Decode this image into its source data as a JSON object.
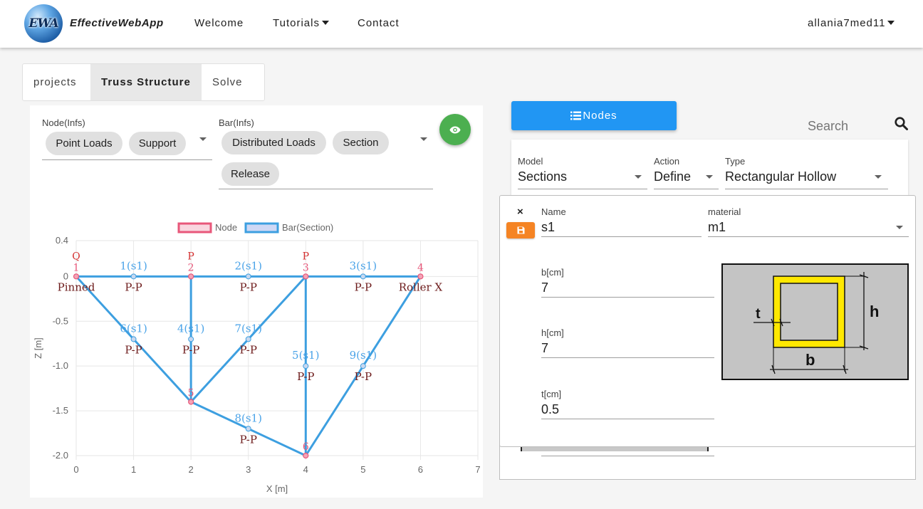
{
  "navbar": {
    "logo_text": "EWA",
    "brand": "EffectiveWebApp",
    "links": [
      {
        "label": "Welcome"
      },
      {
        "label": "Tutorials"
      },
      {
        "label": "Contact"
      }
    ],
    "user": "allania7med11"
  },
  "tabs": [
    {
      "label": "projects"
    },
    {
      "label": "Truss Structure"
    },
    {
      "label": "Solve"
    }
  ],
  "left_panel": {
    "node_infos": {
      "label": "Node(Infs)",
      "chips": [
        "Point Loads",
        "Support"
      ]
    },
    "bar_infos": {
      "label": "Bar(Infs)",
      "chips": [
        "Distributed Loads",
        "Section",
        "Release"
      ]
    },
    "eye_icon": "eye-icon"
  },
  "chart_data": {
    "type": "scatter",
    "title": "",
    "xlabel": "X [m]",
    "ylabel": "Z [m]",
    "xlim": [
      0,
      7
    ],
    "ylim": [
      -2.0,
      0.4
    ],
    "x_ticks": [
      "0",
      "1",
      "2",
      "3",
      "4",
      "5",
      "6",
      "7"
    ],
    "y_ticks": [
      "0.4",
      "0",
      "-0.5",
      "-1.0",
      "-1.5",
      "-2.0"
    ],
    "legend": [
      {
        "name": "Node",
        "color": "#e8577a"
      },
      {
        "name": "Bar(Section)",
        "color": "#3d9fe0"
      }
    ],
    "grid": true,
    "nodes": [
      {
        "id": "1",
        "x": 0,
        "y": 0,
        "support": "Pinned",
        "load": "Q"
      },
      {
        "id": "2",
        "x": 2,
        "y": 0,
        "support": "",
        "load": "P"
      },
      {
        "id": "3",
        "x": 4,
        "y": 0,
        "support": "",
        "load": "P"
      },
      {
        "id": "4",
        "x": 6,
        "y": 0,
        "support": "Roller X",
        "load": ""
      },
      {
        "id": "5",
        "x": 2,
        "y": -1.4,
        "support": "",
        "load": ""
      },
      {
        "id": "6",
        "x": 4,
        "y": -2.0,
        "support": "",
        "load": ""
      }
    ],
    "bars": [
      {
        "label": "1(s1)",
        "release": "P-P",
        "x1": 0,
        "y1": 0,
        "x2": 2,
        "y2": 0
      },
      {
        "label": "2(s1)",
        "release": "P-P",
        "x1": 2,
        "y1": 0,
        "x2": 4,
        "y2": 0
      },
      {
        "label": "3(s1)",
        "release": "P-P",
        "x1": 4,
        "y1": 0,
        "x2": 6,
        "y2": 0
      },
      {
        "label": "4(s1)",
        "release": "P-P",
        "x1": 2,
        "y1": 0,
        "x2": 2,
        "y2": -1.4
      },
      {
        "label": "5(s1)",
        "release": "P-P",
        "x1": 4,
        "y1": 0,
        "x2": 4,
        "y2": -2.0
      },
      {
        "label": "6(s1)",
        "release": "P-P",
        "x1": 0,
        "y1": 0,
        "x2": 2,
        "y2": -1.4
      },
      {
        "label": "7(s1)",
        "release": "P-P",
        "x1": 4,
        "y1": 0,
        "x2": 2,
        "y2": -1.4
      },
      {
        "label": "8(s1)",
        "release": "P-P",
        "x1": 2,
        "y1": -1.4,
        "x2": 4,
        "y2": -2.0
      },
      {
        "label": "9(s1)",
        "release": "P-P",
        "x1": 6,
        "y1": 0,
        "x2": 4,
        "y2": -2.0
      }
    ],
    "colors": {
      "node": "#e8577a",
      "bar": "#3d9fe0",
      "load": "#d32f2f",
      "release": "#6d1b1b"
    }
  },
  "right_panel": {
    "nodes_button": "Nodes",
    "search_placeholder": "Search",
    "model": {
      "label": "Model",
      "value": "Sections"
    },
    "action": {
      "label": "Action",
      "value": "Define"
    },
    "type": {
      "label": "Type",
      "value": "Rectangular Hollow"
    },
    "form": {
      "close": "×",
      "name_label": "Name",
      "name_value": "s1",
      "material_label": "material",
      "material_value": "m1",
      "b_label": "b[cm]",
      "b_value": "7",
      "h_label": "h[cm]",
      "h_value": "7",
      "t_label": "t[cm]",
      "t_value": "0.5"
    },
    "section_figure": {
      "t": "t",
      "h": "h",
      "b": "b"
    }
  }
}
